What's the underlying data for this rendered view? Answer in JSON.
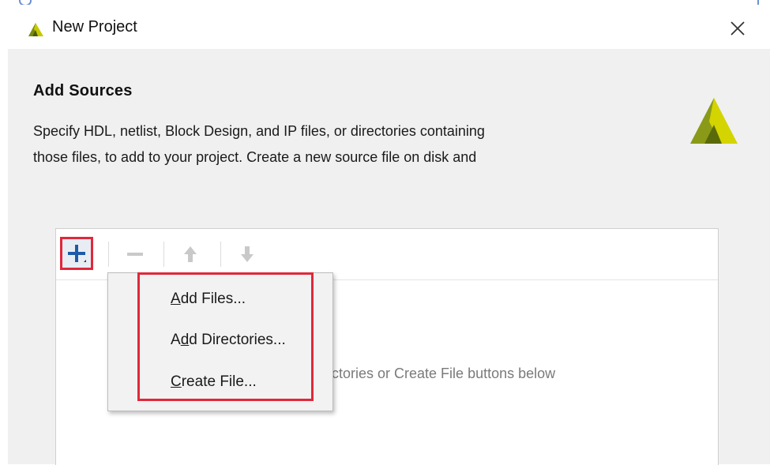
{
  "window": {
    "title": "New Project",
    "logo_icon": "vivado-logo-icon",
    "close_icon": "close-icon"
  },
  "page": {
    "heading": "Add Sources",
    "description_line1": "Specify HDL, netlist, Block Design, and IP files, or directories containing",
    "description_line2": "those files, to add to your project. Create a new source file on disk and"
  },
  "toolbar": {
    "add_icon": "plus-icon",
    "remove_icon": "minus-icon",
    "move_up_icon": "arrow-up-icon",
    "move_down_icon": "arrow-down-icon"
  },
  "sources_list": {
    "empty_hint": "ectories or Create File buttons below"
  },
  "add_menu": {
    "items": [
      {
        "label_pre": "",
        "mnemonic": "A",
        "label_post": "dd Files..."
      },
      {
        "label_pre": "A",
        "mnemonic": "d",
        "label_post": "d Directories..."
      },
      {
        "label_pre": "",
        "mnemonic": "C",
        "label_post": "reate File..."
      }
    ]
  },
  "colors": {
    "highlight_red": "#e0283a",
    "logo_olive": "#7a8a10",
    "logo_yellow": "#c8c800",
    "add_blue": "#1f5aa8",
    "panel_bg": "#f0f0f0"
  }
}
